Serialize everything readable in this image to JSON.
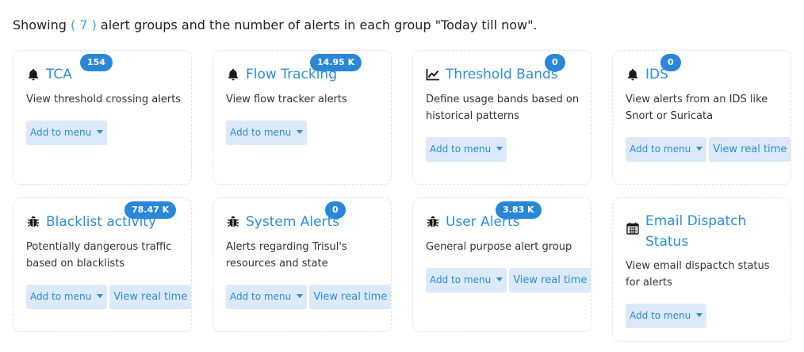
{
  "summary": {
    "prefix": "Showing ",
    "count": "( 7 )",
    "suffix": " alert groups and the number of alerts in each group \"Today till now\"."
  },
  "labels": {
    "add_to_menu": "Add to menu",
    "view_real_time": "View real time"
  },
  "cards": [
    {
      "title": "TCA",
      "badge": "154",
      "description": "View threshold crossing alerts",
      "icon": "bell-icon"
    },
    {
      "title": "Flow Tracking",
      "badge": "14.95 K",
      "description": "View flow tracker alerts",
      "icon": "bell-icon"
    },
    {
      "title": "Threshold Bands",
      "badge": "0",
      "description": "Define usage bands based on historical patterns",
      "icon": "line-chart-icon"
    },
    {
      "title": "IDS",
      "badge": "0",
      "description": "View alerts from an IDS like Snort or Suricata",
      "icon": "bell-icon"
    },
    {
      "title": "Blacklist activity",
      "badge": "78.47 K",
      "description": "Potentially dangerous traffic based on blacklists",
      "icon": "bug-icon"
    },
    {
      "title": "System Alerts",
      "badge": "0",
      "description": "Alerts regarding Trisul's resources and state",
      "icon": "bug-icon"
    },
    {
      "title": "User Alerts",
      "badge": "3.83 K",
      "description": "General purpose alert group",
      "icon": "bug-icon"
    },
    {
      "title": "Email Dispatch Status",
      "badge": "",
      "description": "View email dispactch status for alerts",
      "icon": "calendar-icon"
    }
  ]
}
